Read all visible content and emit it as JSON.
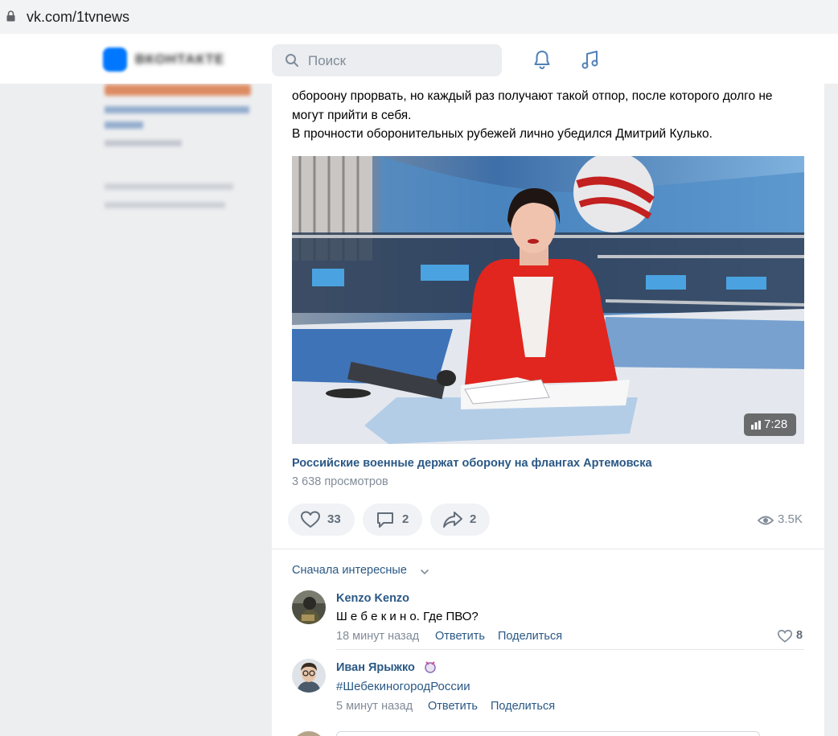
{
  "browser": {
    "url": "vk.com/1tvnews"
  },
  "header": {
    "logo_text": "ВКОНТАКТЕ",
    "search_placeholder": "Поиск"
  },
  "post": {
    "text_lines": [
      "обороону прорвать, но каждый раз получают такой отпор, после которого долго не",
      "могут прийти в себя.",
      "В прочности оборонительных рубежей лично убедился Дмитрий Кулько."
    ],
    "video": {
      "duration": "7:28",
      "title": "Российские военные держат оборону на флангах Артемовска",
      "views": "3 638 просмотров"
    },
    "actions": {
      "likes": "33",
      "comments": "2",
      "shares": "2",
      "views": "3.5K"
    }
  },
  "comments": {
    "sort_label": "Сначала интересные",
    "items": [
      {
        "author": "Kenzo Kenzo",
        "text": "Ш е б е к и н о. Где ПВО?",
        "time": "18 минут назад",
        "reply": "Ответить",
        "share": "Поделиться",
        "likes": "8"
      },
      {
        "author": "Иван Ярыжко",
        "text": "#ШебекиногородРоссии",
        "time": "5 минут назад",
        "reply": "Ответить",
        "share": "Поделиться"
      }
    ]
  },
  "colors": {
    "link": "#2a5885",
    "secondary": "#818c99",
    "vk_blue": "#0077ff"
  }
}
